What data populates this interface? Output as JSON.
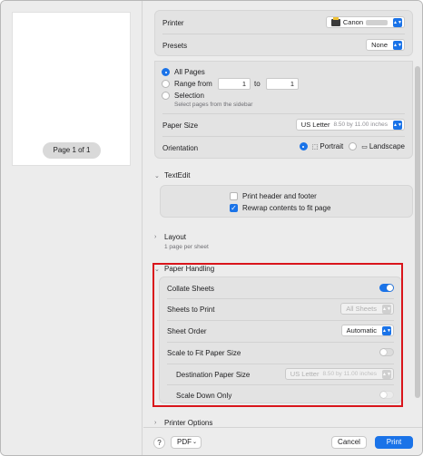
{
  "preview": {
    "page_indicator": "Page 1 of 1"
  },
  "printer": {
    "label": "Printer",
    "value": "Canon"
  },
  "presets": {
    "label": "Presets",
    "value": "None"
  },
  "pages": {
    "all_pages": "All Pages",
    "range_from": "Range from",
    "range_to": "to",
    "range_start": "1",
    "range_end": "1",
    "selection": "Selection",
    "selection_hint": "Select pages from the sidebar"
  },
  "paper_size": {
    "label": "Paper Size",
    "value": "US Letter",
    "detail": "8.50 by 11.00 inches"
  },
  "orientation": {
    "label": "Orientation",
    "portrait": "Portrait",
    "landscape": "Landscape"
  },
  "textedit": {
    "title": "TextEdit",
    "print_header_footer": "Print header and footer",
    "rewrap": "Rewrap contents to fit page"
  },
  "layout": {
    "title": "Layout",
    "subtitle": "1 page per sheet"
  },
  "paper_handling": {
    "title": "Paper Handling",
    "collate_label": "Collate Sheets",
    "sheets_to_print_label": "Sheets to Print",
    "sheets_to_print_value": "All Sheets",
    "sheet_order_label": "Sheet Order",
    "sheet_order_value": "Automatic",
    "scale_label": "Scale to Fit Paper Size",
    "dest_label": "Destination Paper Size",
    "dest_value": "US Letter",
    "dest_detail": "8.50 by 11.00 inches",
    "scale_down_label": "Scale Down Only"
  },
  "printer_options": {
    "title": "Printer Options"
  },
  "footer": {
    "help": "?",
    "pdf": "PDF",
    "cancel": "Cancel",
    "print": "Print"
  },
  "colors": {
    "accent": "#1a73e8",
    "highlight": "#d9151b"
  }
}
